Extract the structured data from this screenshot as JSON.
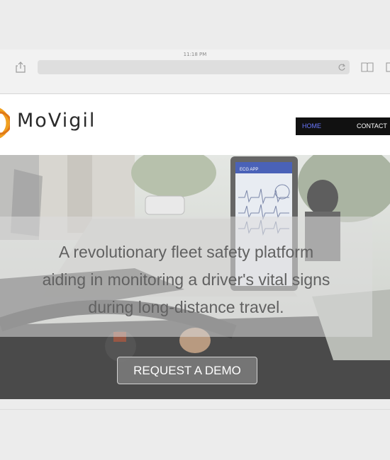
{
  "browser": {
    "clock": "11:18 PM",
    "icons": [
      "share-icon",
      "reload-icon",
      "bookmarks-icon",
      "tabs-icon"
    ]
  },
  "site": {
    "logo_text": "MoVigil",
    "nav": {
      "home": "HOME",
      "contact": "CONTACT"
    },
    "colors": {
      "nav_bg": "#111111",
      "nav_active": "#6a78ff",
      "logo_accent": "#f0a020"
    }
  },
  "hero": {
    "headline_lines": [
      "A revolutionary fleet safety platform",
      "aiding in monitoring a driver's vital signs",
      "during long-distance travel."
    ],
    "button_label": "REQUEST A DEMO",
    "phone_app_title": "ECG APP"
  }
}
